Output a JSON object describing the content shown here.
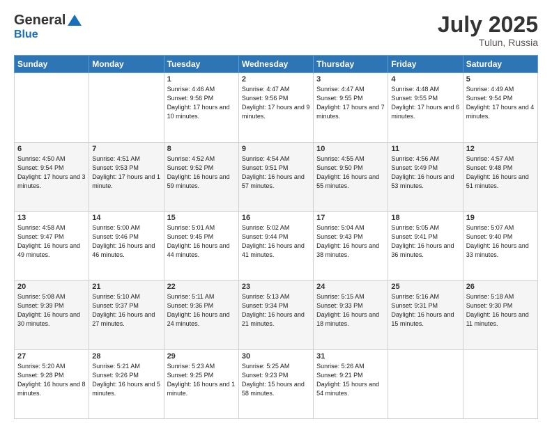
{
  "logo": {
    "general": "General",
    "blue": "Blue"
  },
  "header": {
    "title": "July 2025",
    "subtitle": "Tulun, Russia"
  },
  "days_of_week": [
    "Sunday",
    "Monday",
    "Tuesday",
    "Wednesday",
    "Thursday",
    "Friday",
    "Saturday"
  ],
  "weeks": [
    [
      {
        "day": "",
        "info": ""
      },
      {
        "day": "",
        "info": ""
      },
      {
        "day": "1",
        "info": "Sunrise: 4:46 AM\nSunset: 9:56 PM\nDaylight: 17 hours\nand 10 minutes."
      },
      {
        "day": "2",
        "info": "Sunrise: 4:47 AM\nSunset: 9:56 PM\nDaylight: 17 hours\nand 9 minutes."
      },
      {
        "day": "3",
        "info": "Sunrise: 4:47 AM\nSunset: 9:55 PM\nDaylight: 17 hours\nand 7 minutes."
      },
      {
        "day": "4",
        "info": "Sunrise: 4:48 AM\nSunset: 9:55 PM\nDaylight: 17 hours\nand 6 minutes."
      },
      {
        "day": "5",
        "info": "Sunrise: 4:49 AM\nSunset: 9:54 PM\nDaylight: 17 hours\nand 4 minutes."
      }
    ],
    [
      {
        "day": "6",
        "info": "Sunrise: 4:50 AM\nSunset: 9:54 PM\nDaylight: 17 hours\nand 3 minutes."
      },
      {
        "day": "7",
        "info": "Sunrise: 4:51 AM\nSunset: 9:53 PM\nDaylight: 17 hours\nand 1 minute."
      },
      {
        "day": "8",
        "info": "Sunrise: 4:52 AM\nSunset: 9:52 PM\nDaylight: 16 hours\nand 59 minutes."
      },
      {
        "day": "9",
        "info": "Sunrise: 4:54 AM\nSunset: 9:51 PM\nDaylight: 16 hours\nand 57 minutes."
      },
      {
        "day": "10",
        "info": "Sunrise: 4:55 AM\nSunset: 9:50 PM\nDaylight: 16 hours\nand 55 minutes."
      },
      {
        "day": "11",
        "info": "Sunrise: 4:56 AM\nSunset: 9:49 PM\nDaylight: 16 hours\nand 53 minutes."
      },
      {
        "day": "12",
        "info": "Sunrise: 4:57 AM\nSunset: 9:48 PM\nDaylight: 16 hours\nand 51 minutes."
      }
    ],
    [
      {
        "day": "13",
        "info": "Sunrise: 4:58 AM\nSunset: 9:47 PM\nDaylight: 16 hours\nand 49 minutes."
      },
      {
        "day": "14",
        "info": "Sunrise: 5:00 AM\nSunset: 9:46 PM\nDaylight: 16 hours\nand 46 minutes."
      },
      {
        "day": "15",
        "info": "Sunrise: 5:01 AM\nSunset: 9:45 PM\nDaylight: 16 hours\nand 44 minutes."
      },
      {
        "day": "16",
        "info": "Sunrise: 5:02 AM\nSunset: 9:44 PM\nDaylight: 16 hours\nand 41 minutes."
      },
      {
        "day": "17",
        "info": "Sunrise: 5:04 AM\nSunset: 9:43 PM\nDaylight: 16 hours\nand 38 minutes."
      },
      {
        "day": "18",
        "info": "Sunrise: 5:05 AM\nSunset: 9:41 PM\nDaylight: 16 hours\nand 36 minutes."
      },
      {
        "day": "19",
        "info": "Sunrise: 5:07 AM\nSunset: 9:40 PM\nDaylight: 16 hours\nand 33 minutes."
      }
    ],
    [
      {
        "day": "20",
        "info": "Sunrise: 5:08 AM\nSunset: 9:39 PM\nDaylight: 16 hours\nand 30 minutes."
      },
      {
        "day": "21",
        "info": "Sunrise: 5:10 AM\nSunset: 9:37 PM\nDaylight: 16 hours\nand 27 minutes."
      },
      {
        "day": "22",
        "info": "Sunrise: 5:11 AM\nSunset: 9:36 PM\nDaylight: 16 hours\nand 24 minutes."
      },
      {
        "day": "23",
        "info": "Sunrise: 5:13 AM\nSunset: 9:34 PM\nDaylight: 16 hours\nand 21 minutes."
      },
      {
        "day": "24",
        "info": "Sunrise: 5:15 AM\nSunset: 9:33 PM\nDaylight: 16 hours\nand 18 minutes."
      },
      {
        "day": "25",
        "info": "Sunrise: 5:16 AM\nSunset: 9:31 PM\nDaylight: 16 hours\nand 15 minutes."
      },
      {
        "day": "26",
        "info": "Sunrise: 5:18 AM\nSunset: 9:30 PM\nDaylight: 16 hours\nand 11 minutes."
      }
    ],
    [
      {
        "day": "27",
        "info": "Sunrise: 5:20 AM\nSunset: 9:28 PM\nDaylight: 16 hours\nand 8 minutes."
      },
      {
        "day": "28",
        "info": "Sunrise: 5:21 AM\nSunset: 9:26 PM\nDaylight: 16 hours\nand 5 minutes."
      },
      {
        "day": "29",
        "info": "Sunrise: 5:23 AM\nSunset: 9:25 PM\nDaylight: 16 hours\nand 1 minute."
      },
      {
        "day": "30",
        "info": "Sunrise: 5:25 AM\nSunset: 9:23 PM\nDaylight: 15 hours\nand 58 minutes."
      },
      {
        "day": "31",
        "info": "Sunrise: 5:26 AM\nSunset: 9:21 PM\nDaylight: 15 hours\nand 54 minutes."
      },
      {
        "day": "",
        "info": ""
      },
      {
        "day": "",
        "info": ""
      }
    ]
  ]
}
